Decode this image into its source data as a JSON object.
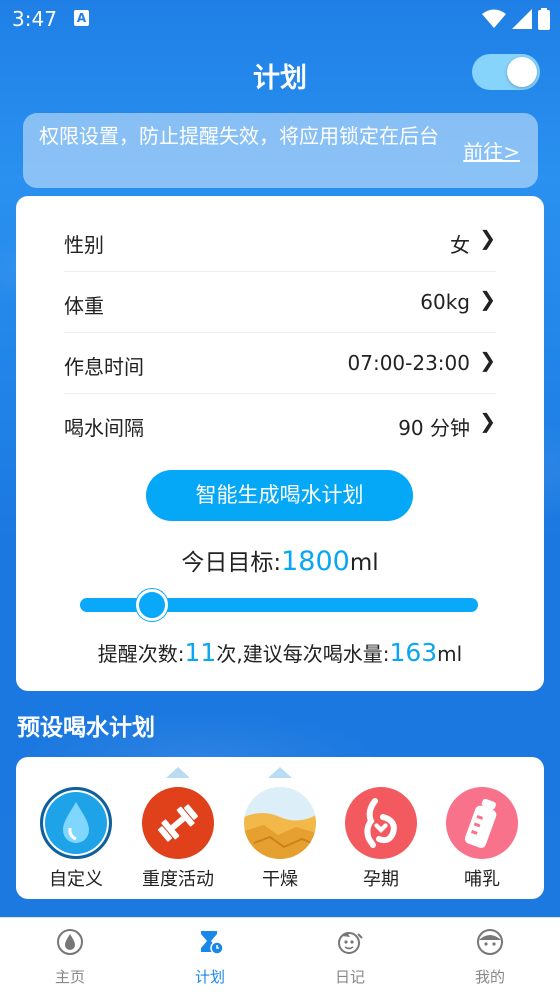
{
  "status_bar": {
    "time": "3:47",
    "notification_icon": "A"
  },
  "header": {
    "title": "计划",
    "toggle_on": true
  },
  "notice": {
    "text": "权限设置，防止提醒失效，将应用锁定在后台",
    "link": "前往>"
  },
  "settings": {
    "rows": [
      {
        "label": "性别",
        "value": "女"
      },
      {
        "label": "体重",
        "value": "60kg"
      },
      {
        "label": "作息时间",
        "value": "07:00-23:00"
      },
      {
        "label": "喝水间隔",
        "value": "90 分钟"
      }
    ],
    "arrow": "❯",
    "generate_button": "智能生成喝水计划",
    "goal_prefix": "今日目标:",
    "goal_value": "1800",
    "goal_unit": "ml",
    "slider_fraction": 0.18,
    "remind_prefix": "提醒次数:",
    "remind_count": "11",
    "remind_middle": "次,建议每次喝水量:",
    "remind_amount": "163",
    "remind_unit": "ml"
  },
  "presets": {
    "title": "预设喝水计划",
    "items": [
      {
        "label": "自定义",
        "icon": "water-drop-icon",
        "selected": true
      },
      {
        "label": "重度活动",
        "icon": "dumbbell-icon",
        "selected": false
      },
      {
        "label": "干燥",
        "icon": "desert-icon",
        "selected": false
      },
      {
        "label": "孕期",
        "icon": "pregnancy-icon",
        "selected": false
      },
      {
        "label": "哺乳",
        "icon": "baby-bottle-icon",
        "selected": false
      }
    ]
  },
  "tabbar": {
    "tabs": [
      {
        "label": "主页",
        "icon": "home-drop-icon",
        "active": false
      },
      {
        "label": "计划",
        "icon": "hourglass-icon",
        "active": true
      },
      {
        "label": "日记",
        "icon": "diary-icon",
        "active": false
      },
      {
        "label": "我的",
        "icon": "profile-face-icon",
        "active": false
      }
    ]
  },
  "colors": {
    "accent": "#09a6f3",
    "background": "#1f7fe6",
    "tab_active": "#1a88e8",
    "tab_inactive": "#888888"
  }
}
